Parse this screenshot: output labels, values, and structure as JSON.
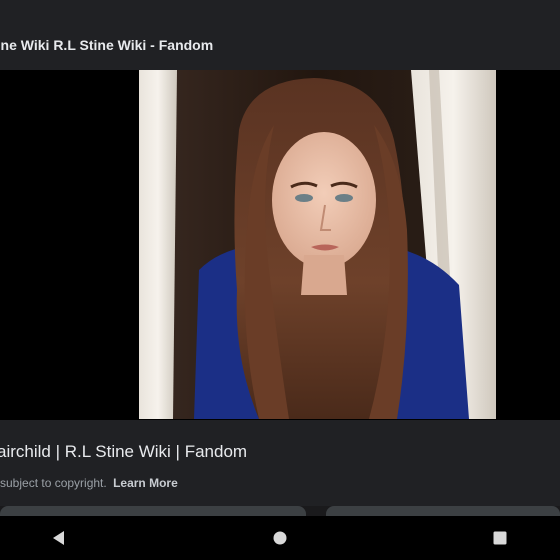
{
  "header": {
    "source_title": "tine Wiki R.L Stine Wiki - Fandom"
  },
  "result": {
    "title": "airchild | R.L Stine Wiki | Fandom",
    "copyright_text": "subject to copyright.",
    "learn_more_label": "Learn More"
  },
  "navigation": {
    "back": "back-icon",
    "home": "home-icon",
    "recents": "recents-icon"
  },
  "colors": {
    "panel": "#202124",
    "text": "#e8eaed",
    "muted": "#9aa0a6"
  }
}
